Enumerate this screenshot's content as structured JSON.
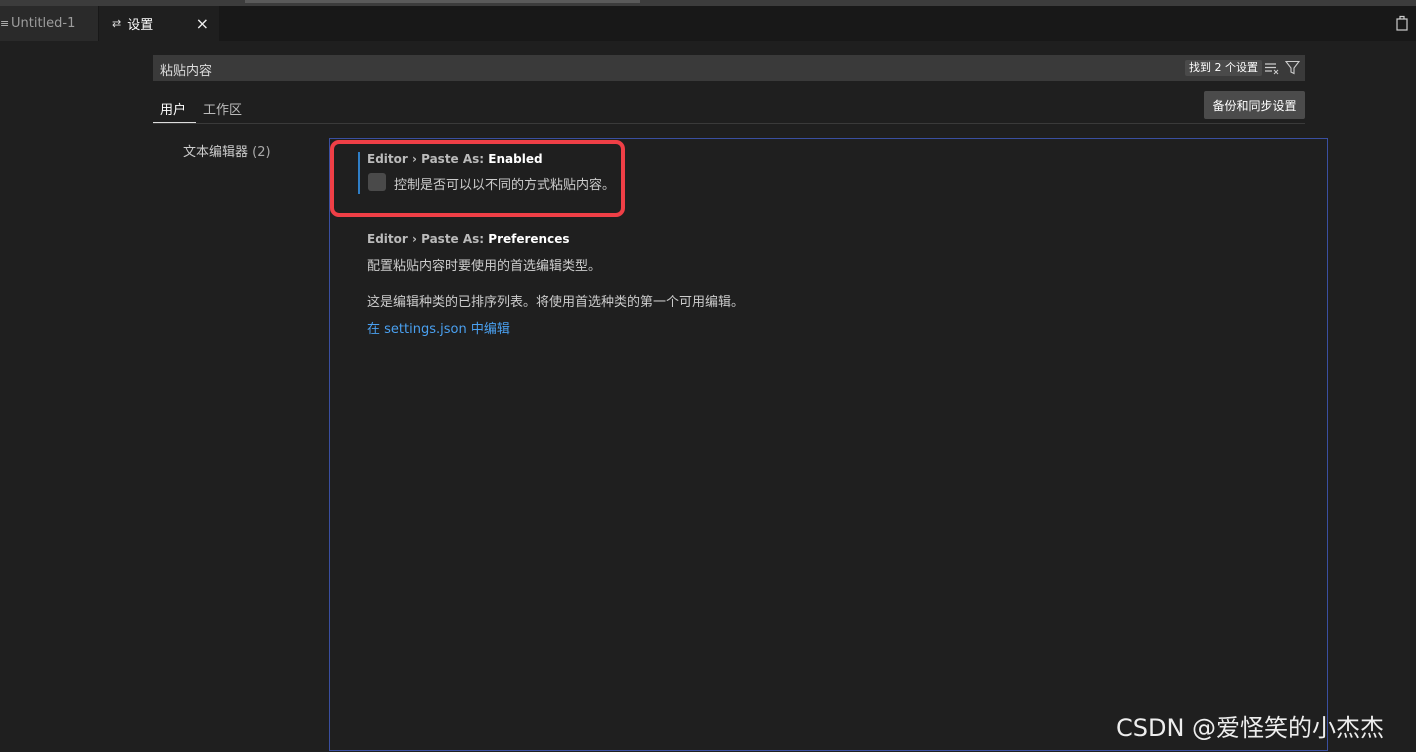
{
  "tabs": [
    {
      "label": "Untitled-1",
      "icon": "file-icon"
    },
    {
      "label": "设置",
      "icon": "settings-icon",
      "close": "×"
    }
  ],
  "search": {
    "value": "粘贴内容",
    "result_count": "找到 2 个设置"
  },
  "scopes": {
    "user": "用户",
    "workspace": "工作区",
    "sync_button": "备份和同步设置"
  },
  "toc": {
    "label": "文本编辑器",
    "count": "(2)"
  },
  "settings": [
    {
      "category": "Editor › Paste As: ",
      "key": "Enabled",
      "description": "控制是否可以以不同的方式粘贴内容。",
      "checked": false
    },
    {
      "category": "Editor › Paste As: ",
      "key": "Preferences",
      "description": "配置粘贴内容时要使用的首选编辑类型。",
      "description2": "这是编辑种类的已排序列表。将使用首选种类的第一个可用编辑。",
      "link": "在 settings.json 中编辑"
    }
  ],
  "watermark": "CSDN @爱怪笑的小杰杰",
  "colors": {
    "highlight": "#ef3f46",
    "link": "#4aa0f0",
    "accent_bar": "#2f7ec6"
  }
}
